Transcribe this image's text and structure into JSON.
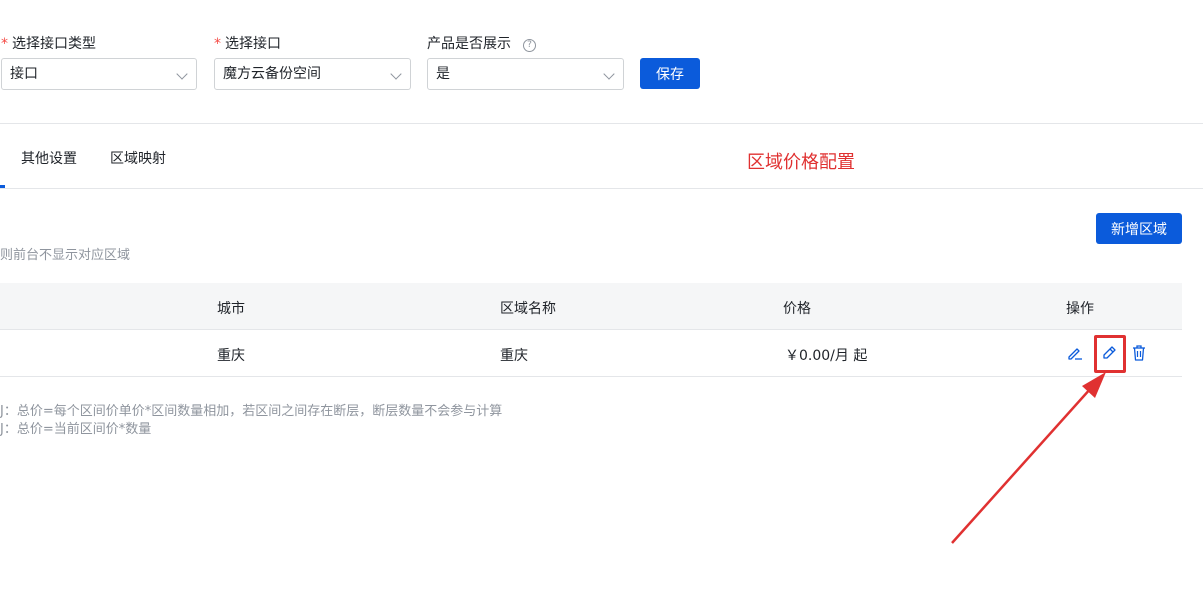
{
  "form": {
    "interface_type": {
      "required_mark": "*",
      "label": "选择接口类型",
      "value": "接口",
      "icon": "chevron-down-icon"
    },
    "interface": {
      "required_mark": "*",
      "label": "选择接口",
      "value": "魔方云备份空间",
      "icon": "chevron-down-icon"
    },
    "product_display": {
      "label": "产品是否展示",
      "help": "?",
      "value": "是",
      "icon": "chevron-down-icon"
    },
    "save_label": "保存"
  },
  "tabs": [
    {
      "label": "其他设置"
    },
    {
      "label": "区域映射"
    }
  ],
  "annotation": {
    "title": "区域价格配置",
    "color": "#e03131"
  },
  "section": {
    "add_region_label": "新增区域",
    "hint": "则前台不显示对应区域"
  },
  "table": {
    "headers": {
      "city": "城市",
      "region_name": "区域名称",
      "price": "价格",
      "actions": "操作"
    },
    "rows": [
      {
        "city": "重庆",
        "region_name": "重庆",
        "price": "￥0.00/月 起",
        "action_icons": [
          "edit-icon",
          "pencil-icon",
          "trash-icon"
        ]
      }
    ]
  },
  "notes": [
    "J：总价=每个区间价单价*区间数量相加，若区间之间存在断层，断层数量不会参与计算",
    "J：总价=当前区间价*数量"
  ],
  "colors": {
    "primary": "#0b5bdb",
    "annotation": "#e03131",
    "muted": "#8f959e"
  }
}
